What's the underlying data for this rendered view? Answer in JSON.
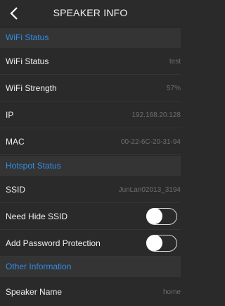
{
  "header": {
    "title": "SPEAKER INFO",
    "back_icon": "chevron-left-icon"
  },
  "colors": {
    "section_text": "#2f8fe6",
    "background": "#2a2a2a",
    "section_background": "#343434"
  },
  "wifi": {
    "section_title": "WiFi Status",
    "status_label": "WiFi Status",
    "status_value": "test",
    "strength_label": "WiFi Strength",
    "strength_value": "57%",
    "ip_label": "IP",
    "ip_value": "192.168.20.128",
    "mac_label": "MAC",
    "mac_value": "00-22-6C-20-31-94"
  },
  "hotspot": {
    "section_title": "Hotspot Status",
    "ssid_label": "SSID",
    "ssid_value": "JunLan02013_3194",
    "hide_ssid_label": "Need Hide SSID",
    "hide_ssid_on": false,
    "password_label": "Add Password Protection",
    "password_on": false
  },
  "other": {
    "section_title": "Other Information",
    "speaker_name_label": "Speaker Name",
    "speaker_name_value": "home"
  }
}
